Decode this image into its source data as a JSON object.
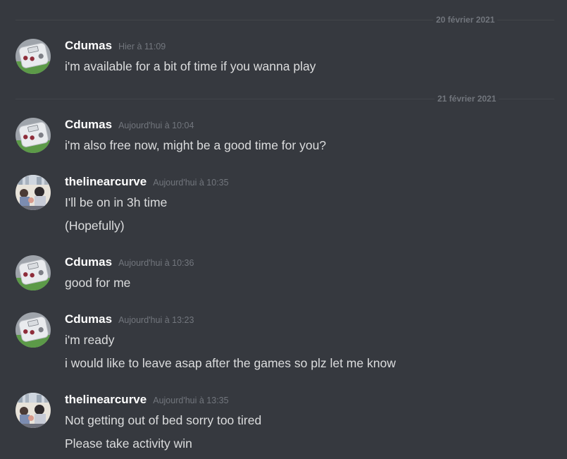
{
  "dividers": [
    {
      "date": "20 février 2021"
    },
    {
      "date": "21 février 2021"
    }
  ],
  "messages": [
    {
      "username": "Cdumas",
      "timestamp": "Hier à 11:09",
      "lines": [
        "i'm available for a bit of time if you wanna play"
      ]
    },
    {
      "username": "Cdumas",
      "timestamp": "Aujourd'hui à 10:04",
      "lines": [
        "i'm also free now, might be a good time for you?"
      ]
    },
    {
      "username": "thelinearcurve",
      "timestamp": "Aujourd'hui à 10:35",
      "lines": [
        "I'll be on in 3h time",
        "(Hopefully)"
      ]
    },
    {
      "username": "Cdumas",
      "timestamp": "Aujourd'hui à 10:36",
      "lines": [
        "good for me"
      ]
    },
    {
      "username": "Cdumas",
      "timestamp": "Aujourd'hui à 13:23",
      "lines": [
        "i'm ready",
        "i would like to leave asap after the games so plz let me know"
      ]
    },
    {
      "username": "thelinearcurve",
      "timestamp": "Aujourd'hui à 13:35",
      "lines": [
        "Not getting out of bed sorry too tired",
        "Please take activity win"
      ]
    }
  ],
  "colors": {
    "background": "#36393f",
    "username": "#ffffff",
    "timestamp": "#72767d",
    "message_text": "#dcddde",
    "divider": "#42454a"
  }
}
